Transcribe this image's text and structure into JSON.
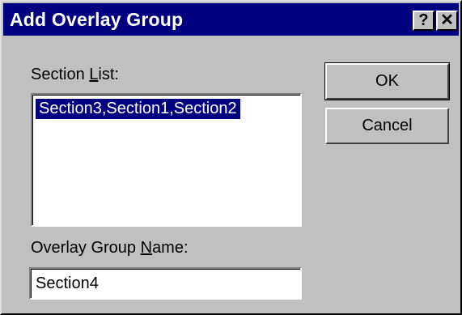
{
  "window": {
    "title": "Add Overlay Group"
  },
  "titlebar_buttons": {
    "help": "?",
    "close": "✕"
  },
  "section_list": {
    "label_pre": "Section ",
    "label_accel": "L",
    "label_post": "ist:",
    "items": [
      "Section3,Section1,Section2"
    ]
  },
  "group_name": {
    "label_pre": "Overlay Group ",
    "label_accel": "N",
    "label_post": "ame:",
    "value": "Section4"
  },
  "buttons": {
    "ok": "OK",
    "cancel": "Cancel"
  },
  "colors": {
    "titlebar": "#000080",
    "face": "#c0c0c0",
    "selection": "#000080"
  }
}
